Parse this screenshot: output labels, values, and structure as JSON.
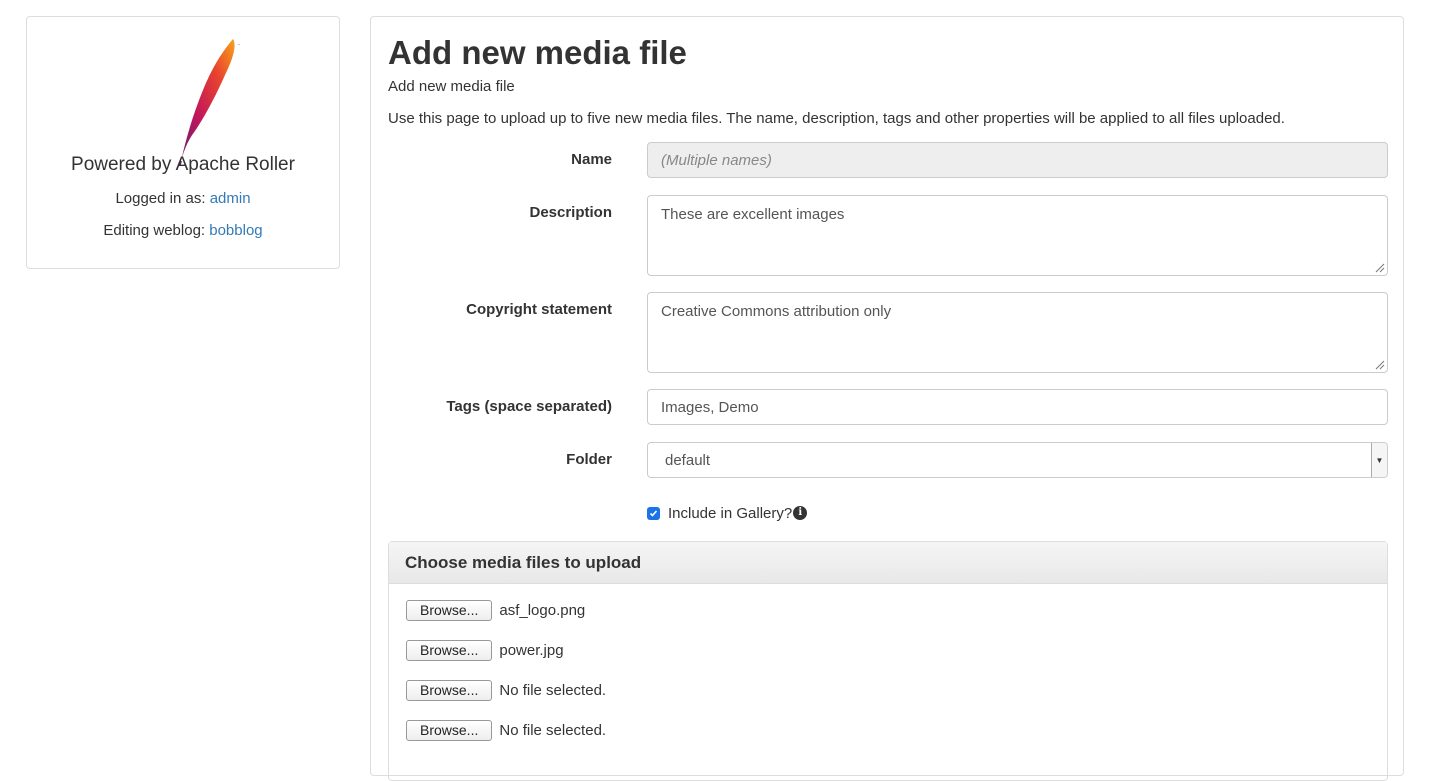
{
  "sidebar": {
    "powered_by": "Powered by Apache Roller",
    "logged_in_prefix": "Logged in as: ",
    "logged_in_user": "admin",
    "editing_prefix": "Editing weblog: ",
    "editing_weblog": "bobblog",
    "logo_icon": "apache-feather-icon"
  },
  "main": {
    "title": "Add new media file",
    "subtitle": "Add new media file",
    "intro": "Use this page to upload up to five new media files. The name, description, tags and other properties will be applied to all files uploaded.",
    "form": {
      "name_label": "Name",
      "name_value": "(Multiple names)",
      "description_label": "Description",
      "description_value": "These are excellent images",
      "copyright_label": "Copyright statement",
      "copyright_value": "Creative Commons attribution only",
      "tags_label": "Tags (space separated)",
      "tags_value": "Images, Demo",
      "folder_label": "Folder",
      "folder_value": "default",
      "gallery_label": "Include in Gallery?",
      "gallery_checked": true,
      "info_icon": "i"
    },
    "upload": {
      "heading": "Choose media files to upload",
      "browse_label": "Browse...",
      "files": [
        "asf_logo.png",
        "power.jpg",
        "No file selected.",
        "No file selected."
      ]
    }
  },
  "colors": {
    "link": "#337ab7",
    "checkbox": "#1a73e8",
    "border": "#dddddd",
    "disabled_bg": "#eeeeee"
  }
}
